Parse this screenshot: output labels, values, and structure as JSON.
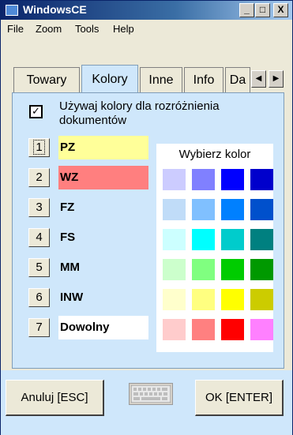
{
  "window": {
    "title": "WindowsCE",
    "minimize": "_",
    "maximize": "□",
    "close": "X"
  },
  "menu": [
    "File",
    "Zoom",
    "Tools",
    "Help"
  ],
  "tabs": [
    "Towary",
    "Kolory",
    "Inne",
    "Info",
    "Da"
  ],
  "active_tab": "Kolory",
  "tab_scroll": {
    "left": "◀",
    "right": "▶"
  },
  "checkbox": {
    "checked": true,
    "mark": "✓",
    "label": "Używaj kolory dla rozróżnienia dokumentów"
  },
  "documents": [
    {
      "number": "1",
      "label": "PZ",
      "color": "#ffff99",
      "focused": true
    },
    {
      "number": "2",
      "label": "WZ",
      "color": "#ff7f7f",
      "focused": false
    },
    {
      "number": "3",
      "label": "FZ",
      "color": "",
      "focused": false
    },
    {
      "number": "4",
      "label": "FS",
      "color": "",
      "focused": false
    },
    {
      "number": "5",
      "label": "MM",
      "color": "",
      "focused": false
    },
    {
      "number": "6",
      "label": "INW",
      "color": "",
      "focused": false
    },
    {
      "number": "7",
      "label": "Dowolny",
      "color": "#ffffff",
      "focused": false
    }
  ],
  "color_picker": {
    "title": "Wybierz kolor",
    "palette": [
      [
        "#ccccff",
        "#8080ff",
        "#0000ff",
        "#0000cc"
      ],
      [
        "#c0dcf8",
        "#80c0ff",
        "#0080ff",
        "#0050cc"
      ],
      [
        "#ccffff",
        "#00ffff",
        "#00cccc",
        "#008080"
      ],
      [
        "#ccffcc",
        "#80ff80",
        "#00cc00",
        "#009900"
      ],
      [
        "#ffffcc",
        "#ffff80",
        "#ffff00",
        "#cccc00"
      ],
      [
        "#ffcccc",
        "#ff8080",
        "#ff0000",
        "#ff80ff"
      ]
    ]
  },
  "buttons": {
    "cancel": "Anuluj [ESC]",
    "ok": "OK [ENTER]"
  }
}
